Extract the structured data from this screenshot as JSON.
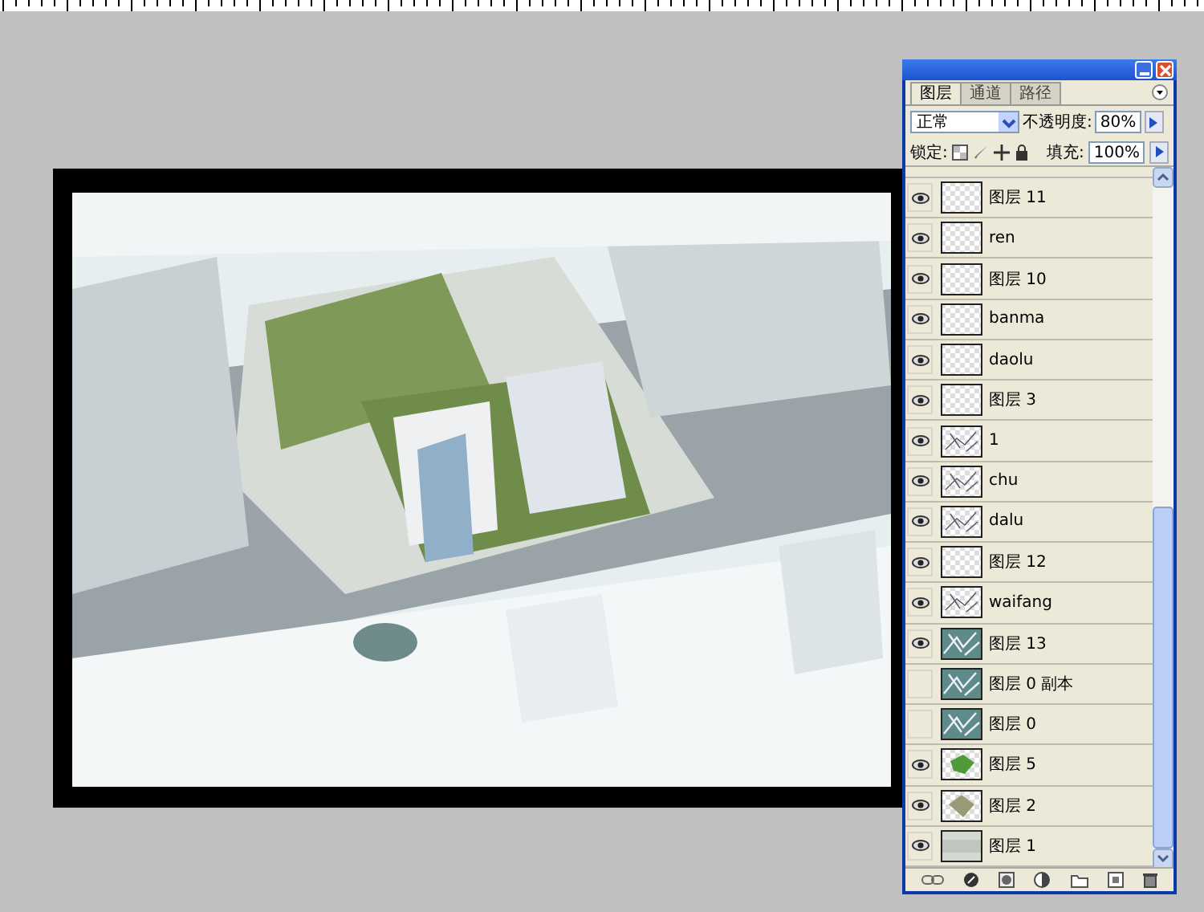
{
  "layers_panel": {
    "tabs": [
      {
        "label": "图层",
        "selected": true
      },
      {
        "label": "通道",
        "selected": false
      },
      {
        "label": "路径",
        "selected": false
      }
    ],
    "blend_mode": "正常",
    "opacity_label": "不透明度:",
    "opacity": "80%",
    "lock_label": "锁定:",
    "fill_label": "填充:",
    "fill": "100%",
    "layers": [
      {
        "name": "图层 11",
        "visible": true,
        "kind": "empty"
      },
      {
        "name": "ren",
        "visible": true,
        "kind": "empty"
      },
      {
        "name": "图层 10",
        "visible": true,
        "kind": "empty"
      },
      {
        "name": "banma",
        "visible": true,
        "kind": "empty"
      },
      {
        "name": "daolu",
        "visible": true,
        "kind": "empty"
      },
      {
        "name": "图层 3",
        "visible": true,
        "kind": "empty"
      },
      {
        "name": "1",
        "visible": true,
        "kind": "sketch"
      },
      {
        "name": "chu",
        "visible": true,
        "kind": "sketch"
      },
      {
        "name": "dalu",
        "visible": true,
        "kind": "sketch"
      },
      {
        "name": "图层 12",
        "visible": true,
        "kind": "empty"
      },
      {
        "name": "waifang",
        "visible": true,
        "kind": "sketch"
      },
      {
        "name": "图层 13",
        "visible": true
      },
      {
        "name": "图层 0 副本",
        "visible": false
      },
      {
        "name": "图层 0",
        "visible": false
      },
      {
        "name": "图层 5",
        "visible": true,
        "kind": "green"
      },
      {
        "name": "图层 2",
        "visible": true,
        "kind": "blob"
      },
      {
        "name": "图层 1",
        "visible": true,
        "kind": "gradient"
      }
    ]
  }
}
